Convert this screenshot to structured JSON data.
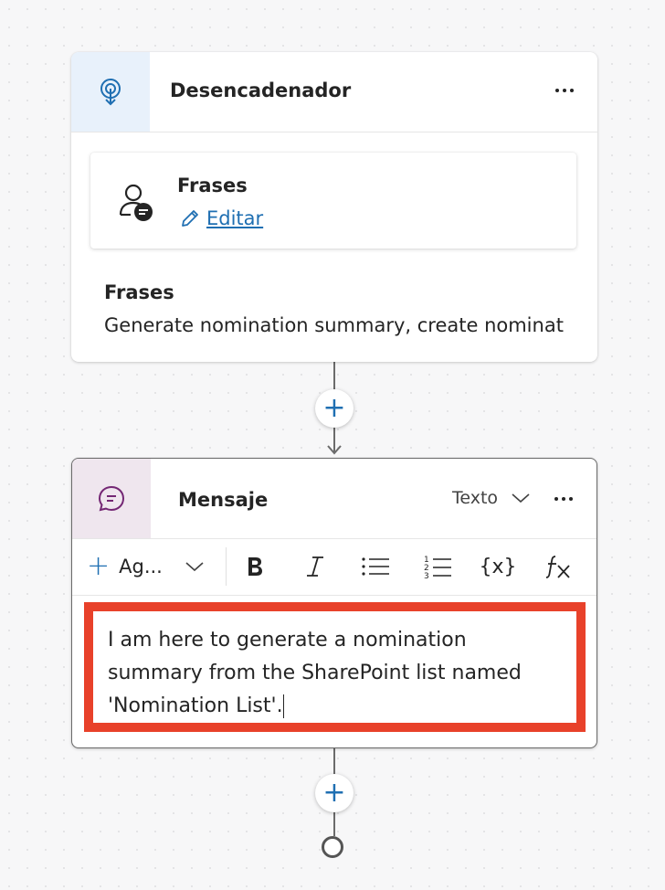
{
  "trigger": {
    "title": "Desencadenador",
    "icon": "trigger-icon",
    "phrases_card": {
      "title": "Frases",
      "edit_label": "Editar",
      "icon": "user-message-icon"
    },
    "section_title": "Frases",
    "section_text": "Generate nomination summary, create nomination"
  },
  "message": {
    "title": "Mensaje",
    "icon": "chat-icon",
    "type_select": "Texto",
    "toolbar": {
      "add_label": "Ag...",
      "variable_label": "{x}"
    },
    "text": "I am here to generate a nomination summary from the SharePoint list named 'Nomination List'."
  },
  "colors": {
    "accent": "#1f6fb2",
    "highlight": "#e8412a"
  }
}
